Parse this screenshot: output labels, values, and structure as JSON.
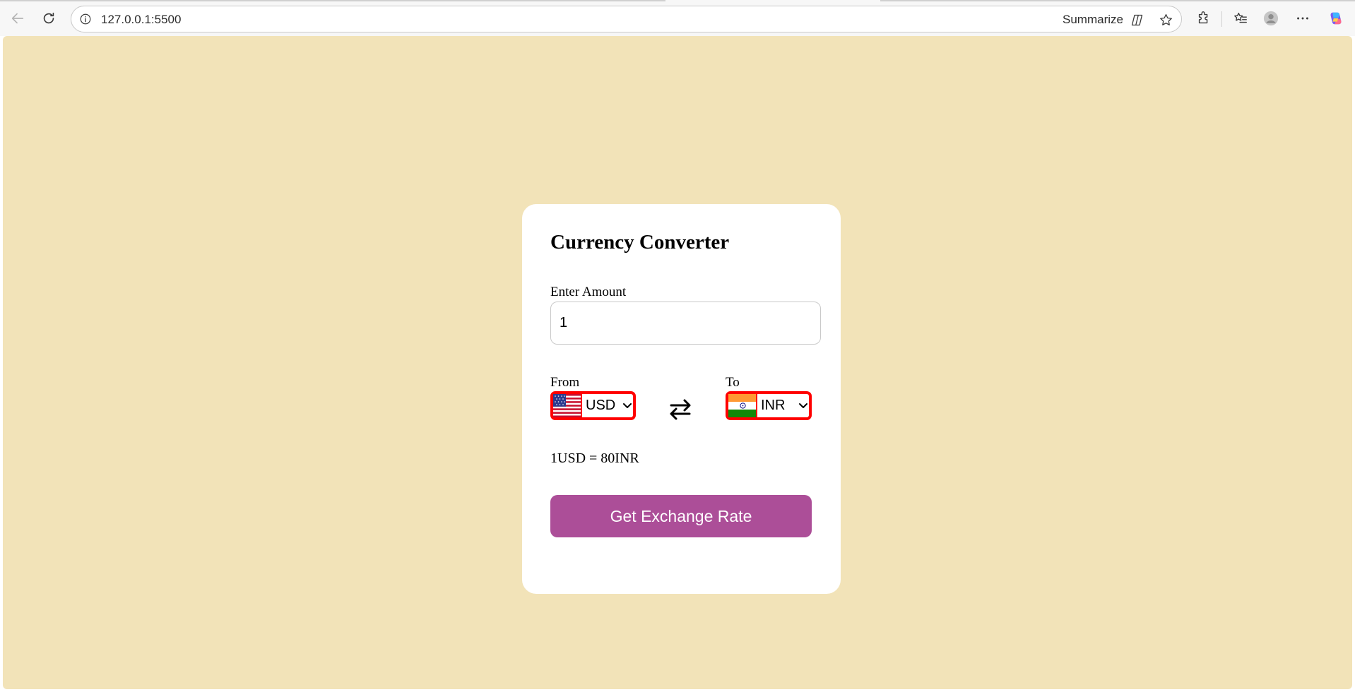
{
  "browser": {
    "url": "127.0.0.1:5500",
    "summarize_label": "Summarize"
  },
  "converter": {
    "title": "Currency Converter",
    "amount_label": "Enter Amount",
    "amount_value": "1",
    "from_label": "From",
    "from_currency": "USD",
    "from_flag": "us-flag-icon",
    "to_label": "To",
    "to_currency": "INR",
    "to_flag": "india-flag-icon",
    "rate_text": "1USD = 80INR",
    "button_label": "Get Exchange Rate"
  },
  "colors": {
    "page_background": "#f2e3b8",
    "card_background": "#ffffff",
    "button_background": "#ac4e98",
    "select_border": "#ff0000"
  }
}
